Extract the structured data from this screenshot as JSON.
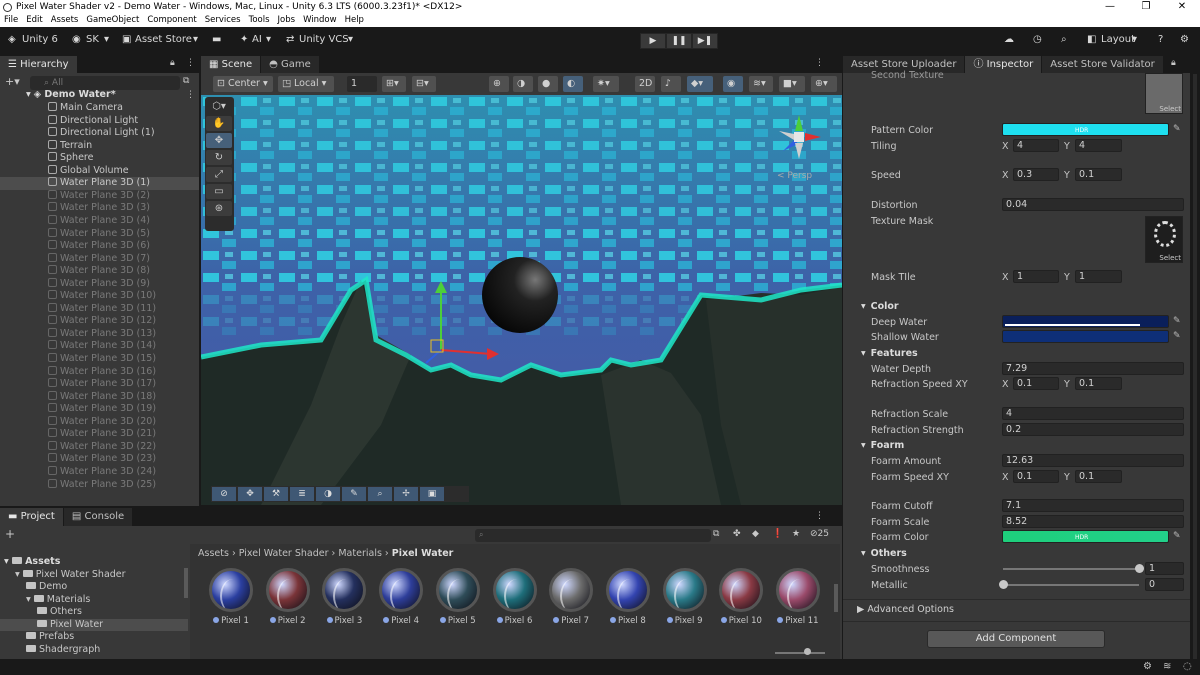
{
  "window": {
    "title": "Pixel Water Shader v2 - Demo Water - Windows, Mac, Linux - Unity 6.3 LTS (6000.3.23f1)* <DX12>",
    "controls": [
      "—",
      "❐",
      "✕"
    ]
  },
  "menubar": [
    "File",
    "Edit",
    "Assets",
    "GameObject",
    "Component",
    "Services",
    "Tools",
    "Jobs",
    "Window",
    "Help"
  ],
  "toolbar": {
    "unity_label": "Unity 6",
    "account": "SK",
    "asset_store": "Asset Store",
    "ai": "AI",
    "vcs": "Unity VCS",
    "layout": "Layout",
    "play": "▶",
    "pause": "❚❚",
    "step": "▶❚"
  },
  "hierarchy": {
    "tab": "Hierarchy",
    "search_placeholder": "All",
    "scene": "Demo Water*",
    "items": [
      {
        "name": "Main Camera",
        "dim": false
      },
      {
        "name": "Directional Light",
        "dim": false
      },
      {
        "name": "Directional Light (1)",
        "dim": false
      },
      {
        "name": "Terrain",
        "dim": false
      },
      {
        "name": "Sphere",
        "dim": false
      },
      {
        "name": "Global Volume",
        "dim": false
      },
      {
        "name": "Water Plane 3D (1)",
        "dim": false,
        "selected": true
      },
      {
        "name": "Water Plane 3D (2)",
        "dim": true
      },
      {
        "name": "Water Plane 3D (3)",
        "dim": true
      },
      {
        "name": "Water Plane 3D (4)",
        "dim": true
      },
      {
        "name": "Water Plane 3D (5)",
        "dim": true
      },
      {
        "name": "Water Plane 3D (6)",
        "dim": true
      },
      {
        "name": "Water Plane 3D (7)",
        "dim": true
      },
      {
        "name": "Water Plane 3D (8)",
        "dim": true
      },
      {
        "name": "Water Plane 3D (9)",
        "dim": true
      },
      {
        "name": "Water Plane 3D (10)",
        "dim": true
      },
      {
        "name": "Water Plane 3D (11)",
        "dim": true
      },
      {
        "name": "Water Plane 3D (12)",
        "dim": true
      },
      {
        "name": "Water Plane 3D (13)",
        "dim": true
      },
      {
        "name": "Water Plane 3D (14)",
        "dim": true
      },
      {
        "name": "Water Plane 3D (15)",
        "dim": true
      },
      {
        "name": "Water Plane 3D (16)",
        "dim": true
      },
      {
        "name": "Water Plane 3D (17)",
        "dim": true
      },
      {
        "name": "Water Plane 3D (18)",
        "dim": true
      },
      {
        "name": "Water Plane 3D (19)",
        "dim": true
      },
      {
        "name": "Water Plane 3D (20)",
        "dim": true
      },
      {
        "name": "Water Plane 3D (21)",
        "dim": true
      },
      {
        "name": "Water Plane 3D (22)",
        "dim": true
      },
      {
        "name": "Water Plane 3D (23)",
        "dim": true
      },
      {
        "name": "Water Plane 3D (24)",
        "dim": true
      },
      {
        "name": "Water Plane 3D (25)",
        "dim": true
      }
    ]
  },
  "scene_view": {
    "tabs": [
      "Scene",
      "Game"
    ],
    "pivot": "Center",
    "space": "Local",
    "grid_value": "1",
    "persp": "< Persp"
  },
  "project": {
    "tabs": [
      "Project",
      "Console"
    ],
    "hidden_count": "25",
    "tree": [
      {
        "label": "Assets",
        "indent": 0,
        "bold": true
      },
      {
        "label": "Pixel Water Shader",
        "indent": 1
      },
      {
        "label": "Demo",
        "indent": 2
      },
      {
        "label": "Materials",
        "indent": 2
      },
      {
        "label": "Others",
        "indent": 3
      },
      {
        "label": "Pixel Water",
        "indent": 3,
        "selected": true
      },
      {
        "label": "Prefabs",
        "indent": 2
      },
      {
        "label": "Shadergraph",
        "indent": 2
      }
    ],
    "breadcrumb": [
      "Assets",
      "Pixel Water Shader",
      "Materials",
      "Pixel Water"
    ],
    "materials": [
      {
        "name": "Pixel 1",
        "color": "#2b3fa0"
      },
      {
        "name": "Pixel 2",
        "color": "#7a3438"
      },
      {
        "name": "Pixel 3",
        "color": "#24305e"
      },
      {
        "name": "Pixel 4",
        "color": "#2e3e9a"
      },
      {
        "name": "Pixel 5",
        "color": "#2e4c58"
      },
      {
        "name": "Pixel 6",
        "color": "#1e6e7a"
      },
      {
        "name": "Pixel 7",
        "color": "#6c6c6c"
      },
      {
        "name": "Pixel 8",
        "color": "#3344b0"
      },
      {
        "name": "Pixel 9",
        "color": "#2a7a88"
      },
      {
        "name": "Pixel 10",
        "color": "#8a3a44"
      },
      {
        "name": "Pixel 11",
        "color": "#9a4a6a"
      }
    ]
  },
  "inspector": {
    "tabs": [
      "Asset Store Uploader",
      "Inspector",
      "Asset Store Validator"
    ],
    "top_label": "Second Texture",
    "select": "Select",
    "pattern_color": "Pattern Color",
    "pattern_color_hex": "#1ee0f0",
    "tiling": {
      "label": "Tiling",
      "x": "4",
      "y": "4"
    },
    "speed": {
      "label": "Speed",
      "x": "0.3",
      "y": "0.1"
    },
    "distortion": {
      "label": "Distortion",
      "value": "0.04"
    },
    "texture_mask": "Texture Mask",
    "mask_tile": {
      "label": "Mask TIle",
      "x": "1",
      "y": "1"
    },
    "color_header": "Color",
    "deep_water": {
      "label": "Deep Water",
      "hex": "#0a1f5a"
    },
    "shallow_water": {
      "label": "Shallow Water",
      "hex": "#0e2f78"
    },
    "features_header": "Features",
    "water_depth": {
      "label": "Water Depth",
      "value": "7.29"
    },
    "refraction_speed": {
      "label": "Refraction Speed XY",
      "x": "0.1",
      "y": "0.1"
    },
    "refraction_scale": {
      "label": "Refraction Scale",
      "value": "4"
    },
    "refraction_strength": {
      "label": "Refraction Strength",
      "value": "0.2"
    },
    "foarm_header": "Foarm",
    "foarm_amount": {
      "label": "Foarm Amount",
      "value": "12.63"
    },
    "foarm_speed": {
      "label": "Foarm Speed XY",
      "x": "0.1",
      "y": "0.1"
    },
    "foarm_cutoff": {
      "label": "Foarm Cutoff",
      "value": "7.1"
    },
    "foarm_scale": {
      "label": "Foarm Scale",
      "value": "8.52"
    },
    "foarm_color": {
      "label": "Foarm Color",
      "hex": "#22d08a"
    },
    "others_header": "Others",
    "smoothness": {
      "label": "Smoothness",
      "value": "1",
      "fraction": 1
    },
    "metallic": {
      "label": "Metallic",
      "value": "0",
      "fraction": 0
    },
    "advanced": "Advanced Options",
    "add_component": "Add Component",
    "hdr": "HDR"
  },
  "axis_x": "X",
  "axis_y": "Y"
}
